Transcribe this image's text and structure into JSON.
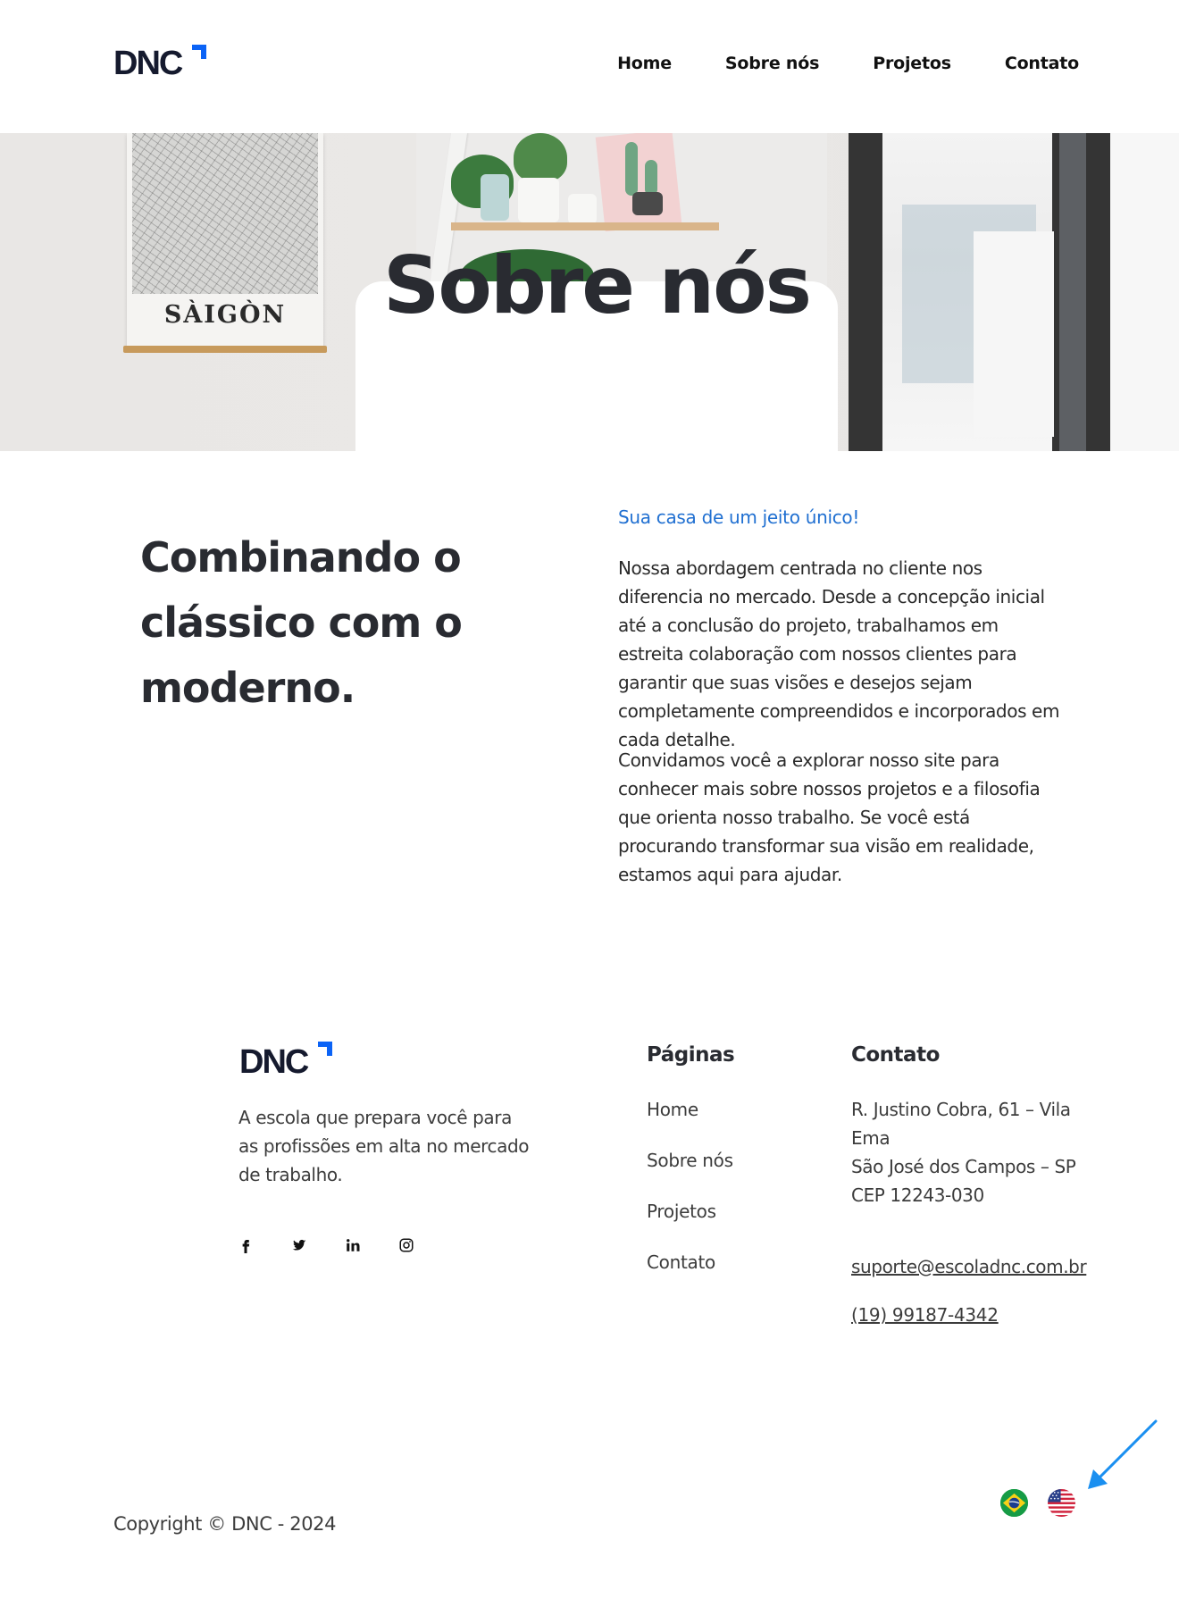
{
  "brand": {
    "logo_text": "DNC",
    "accent_color": "#0b63f6"
  },
  "nav": {
    "items": [
      {
        "label": "Home"
      },
      {
        "label": "Sobre nós"
      },
      {
        "label": "Projetos"
      },
      {
        "label": "Contato"
      }
    ]
  },
  "hero": {
    "title": "Sobre nós",
    "poster_text": "SÀIGÒN"
  },
  "about": {
    "heading": "Combinando o clássico com o moderno.",
    "tagline": "Sua casa de um jeito único!",
    "paragraph_1": "Nossa abordagem centrada no cliente nos diferencia no mercado. Desde a concepção inicial até a conclusão do projeto, trabalhamos em estreita colaboração com nossos clientes para garantir que suas visões e desejos sejam completamente compreendidos e incorporados em cada detalhe.",
    "paragraph_2": "Convidamos você a explorar nosso site para conhecer mais sobre nossos projetos e a filosofia que orienta nosso trabalho. Se você está procurando transformar sua visão em realidade, estamos aqui para ajudar."
  },
  "footer": {
    "logo_text": "DNC",
    "description": "A escola que prepara você para as profissões em alta no mercado de trabalho.",
    "socials": [
      "facebook-icon",
      "twitter-icon",
      "linkedin-icon",
      "instagram-icon"
    ],
    "pages": {
      "title": "Páginas",
      "links": [
        "Home",
        "Sobre nós",
        "Projetos",
        "Contato"
      ]
    },
    "contact": {
      "title": "Contato",
      "address_line_1": "R. Justino Cobra, 61 – Vila Ema",
      "address_line_2": "São José dos Campos – SP",
      "address_line_3": "CEP 12243-030",
      "email": "suporte@escoladnc.com.br",
      "phone": "(19) 99187-4342"
    },
    "copyright": "Copyright © DNC - 2024",
    "languages": [
      "brazil-flag-icon",
      "usa-flag-icon"
    ]
  }
}
